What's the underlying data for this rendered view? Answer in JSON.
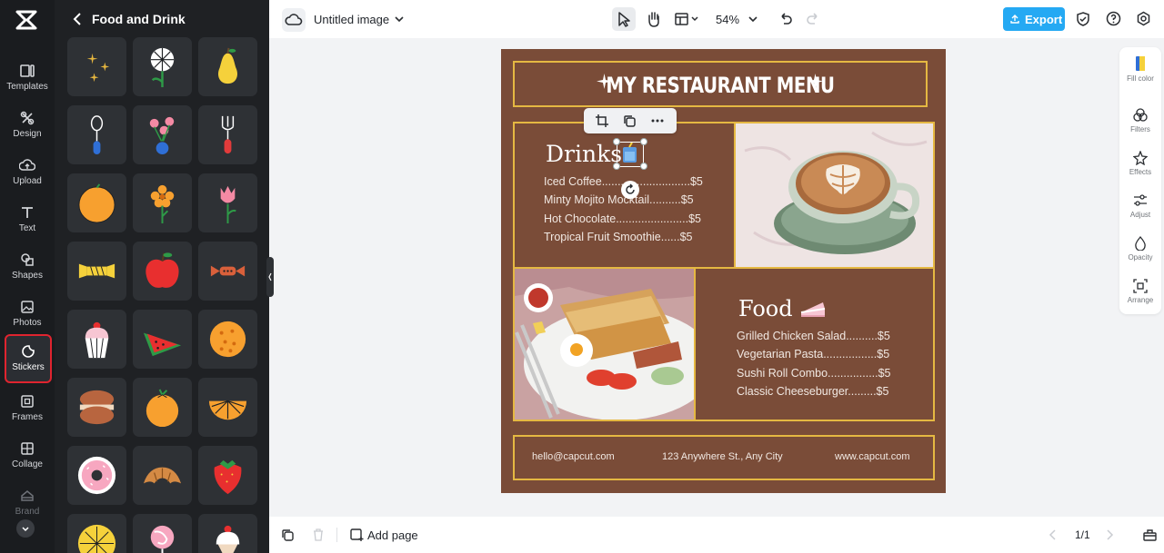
{
  "rail": {
    "items": [
      {
        "label": "Templates",
        "icon": "templates-icon"
      },
      {
        "label": "Design",
        "icon": "design-icon"
      },
      {
        "label": "Upload",
        "icon": "upload-icon"
      },
      {
        "label": "Text",
        "icon": "text-icon"
      },
      {
        "label": "Shapes",
        "icon": "shapes-icon"
      },
      {
        "label": "Photos",
        "icon": "photos-icon"
      },
      {
        "label": "Stickers",
        "icon": "stickers-icon",
        "active": true
      },
      {
        "label": "Frames",
        "icon": "frames-icon"
      },
      {
        "label": "Collage",
        "icon": "collage-icon"
      },
      {
        "label": "Brand",
        "icon": "brand-icon"
      }
    ]
  },
  "panel": {
    "title": "Food and Drink",
    "stickers": [
      "sparkles",
      "lollipop-swirl",
      "pear",
      "spoon",
      "flower-vase",
      "fork",
      "orange",
      "orange-flower",
      "tulip",
      "candy",
      "apple",
      "toffee",
      "cupcake",
      "watermelon-slice",
      "cookie",
      "macaron",
      "mandarin",
      "orange-slice",
      "donut",
      "croissant",
      "strawberry",
      "lemon-slice",
      "lollipop",
      "ice-cream"
    ]
  },
  "topbar": {
    "doc_title": "Untitled image",
    "zoom": "54%",
    "export_label": "Export"
  },
  "canvas": {
    "title": "MY RESTAURANT MENU",
    "drinks_heading": "Drinks",
    "drinks": [
      "Iced Coffee............................$5",
      "Minty Mojito Mocktail..........$5",
      "Hot Chocolate.......................$5",
      "Tropical Fruit Smoothie......$5"
    ],
    "food_heading": "Food",
    "food": [
      "Grilled Chicken Salad..........$5",
      "Vegetarian Pasta.................$5",
      "Sushi Roll Combo................$5",
      "Classic Cheeseburger.........$5"
    ],
    "footer": {
      "email": "hello@capcut.com",
      "address": "123 Anywhere St., Any City",
      "website": "www.capcut.com"
    }
  },
  "right_tools": [
    {
      "label": "Fill color",
      "icon": "fill-color-icon"
    },
    {
      "label": "Filters",
      "icon": "filters-icon"
    },
    {
      "label": "Effects",
      "icon": "effects-icon"
    },
    {
      "label": "Adjust",
      "icon": "adjust-icon"
    },
    {
      "label": "Opacity",
      "icon": "opacity-icon"
    },
    {
      "label": "Arrange",
      "icon": "arrange-icon"
    }
  ],
  "bottombar": {
    "add_page_label": "Add page",
    "page_indicator": "1/1"
  },
  "colors": {
    "canvas_bg": "#7a4c38",
    "gold": "#e5b842",
    "accent": "#25a9f3",
    "active_outline": "#e0242f"
  }
}
